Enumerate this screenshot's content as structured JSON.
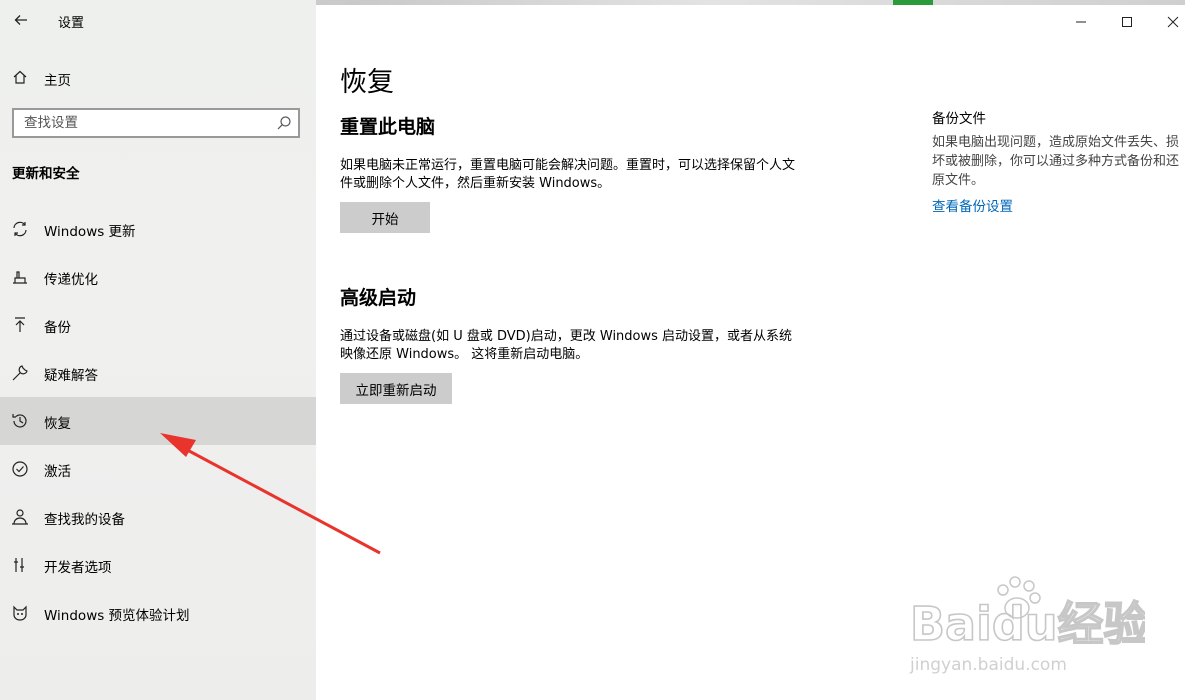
{
  "window": {
    "title": "设置",
    "controls": [
      "minimize",
      "maximize",
      "close"
    ]
  },
  "sidebar": {
    "home_label": "主页",
    "search_placeholder": "查找设置",
    "section_title": "更新和安全",
    "items": [
      {
        "label": "Windows 更新",
        "icon": "sync-icon",
        "selected": false
      },
      {
        "label": "传递优化",
        "icon": "delivery-optimization-icon",
        "selected": false
      },
      {
        "label": "备份",
        "icon": "upload-icon",
        "selected": false
      },
      {
        "label": "疑难解答",
        "icon": "wrench-icon",
        "selected": false
      },
      {
        "label": "恢复",
        "icon": "history-icon",
        "selected": true
      },
      {
        "label": "激活",
        "icon": "check-circle-icon",
        "selected": false
      },
      {
        "label": "查找我的设备",
        "icon": "person-locate-icon",
        "selected": false
      },
      {
        "label": "开发者选项",
        "icon": "developer-tools-icon",
        "selected": false
      },
      {
        "label": "Windows 预览体验计划",
        "icon": "insider-cat-icon",
        "selected": false
      }
    ]
  },
  "main": {
    "page_title": "恢复",
    "reset": {
      "heading": "重置此电脑",
      "description": "如果电脑未正常运行，重置电脑可能会解决问题。重置时，可以选择保留个人文件或删除个人文件，然后重新安装 Windows。",
      "button": "开始"
    },
    "advanced": {
      "heading": "高级启动",
      "description": "通过设备或磁盘(如 U 盘或 DVD)启动，更改 Windows 启动设置，或者从系统映像还原 Windows。 这将重新启动电脑。",
      "button": "立即重新启动"
    },
    "side": {
      "title": "备份文件",
      "description": "如果电脑出现问题，造成原始文件丢失、损坏或被删除，你可以通过多种方式备份和还原文件。",
      "link": "查看备份设置"
    }
  },
  "watermark": {
    "brand": "Baidu经验",
    "url": "jingyan.baidu.com"
  },
  "colors": {
    "accent_link": "#0067b8",
    "annotation_arrow": "#e8342c",
    "selected_bg": "#d6d6d5",
    "button_bg": "#cccccc"
  }
}
